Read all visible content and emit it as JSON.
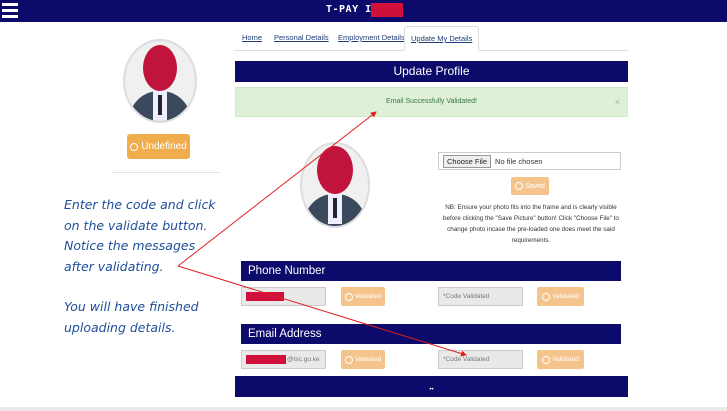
{
  "topbar": {
    "title": "T-PAY ID:"
  },
  "tabs": [
    {
      "label": "Home"
    },
    {
      "label": "Personal Details"
    },
    {
      "label": "Employment Details"
    },
    {
      "label": "Update My Details"
    }
  ],
  "left_panel": {
    "undefined_button": "Undefined"
  },
  "instructions": {
    "line1": "Enter the code and click",
    "line2": "on the validate button.",
    "line3": "Notice the messages",
    "line4": "after validating.",
    "line5": "You will have finished",
    "line6": "uploading details."
  },
  "profile": {
    "header": "Update Profile",
    "alert": "Email Successfully Validated!",
    "alert_close": "×",
    "file_choose": "Choose File",
    "file_status": "No file chosen",
    "saved_button": "Saved",
    "note": "NB: Ensure your photo fits into the frame and is clearly visible before clicking the \"Save Picture\" button! Click \"Choose File\" to change photo incase the pre-loaded one does meet the said requirements."
  },
  "phone": {
    "header": "Phone Number",
    "validated_button": "Validated",
    "code_placeholder": "*Code Validated",
    "validated_button2": "Validated"
  },
  "email": {
    "header": "Email Address",
    "email_suffix": "@tsc.go.ke",
    "validated_button": "Validated",
    "code_placeholder": "*Code Validated",
    "validated_button2": "Validated"
  },
  "footer": {
    "text": "••"
  },
  "colors": {
    "navy": "#0c0a6b",
    "orange": "#f0ad4e",
    "redaction": "#d0103a",
    "alert_green": "#dff0d8"
  }
}
